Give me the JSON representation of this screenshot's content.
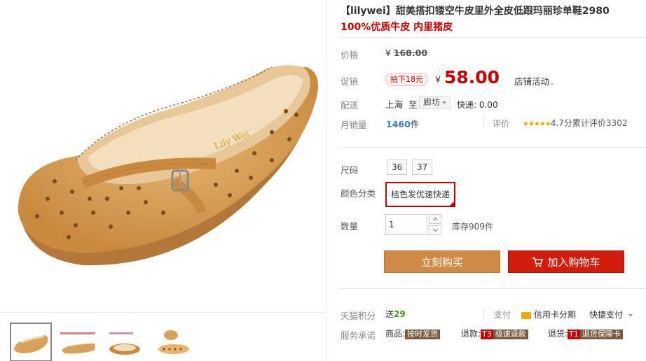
{
  "product": {
    "title": "【lilywei】甜美搭扣镂空牛皮里外全皮低跟玛丽珍单鞋2980",
    "subtitle": "100%优质牛皮 内里猪皮",
    "brand_mark": "Lily Wei"
  },
  "price": {
    "label": "价格",
    "currency": "¥",
    "original": "168.00",
    "promo_label": "促销",
    "promo_badge": "拍下18元",
    "current": "58.00",
    "activity": "店铺活动"
  },
  "shipping": {
    "label": "配送",
    "from": "上海",
    "to_word": "至",
    "destination": "廊坊",
    "express": "快递: 0.00"
  },
  "sales": {
    "label": "月销量",
    "count": "1460",
    "unit": "件",
    "rating_label": "评价",
    "stars": "★★★★★",
    "score": "4.7分",
    "reviews": "累计评价3302"
  },
  "options": {
    "size_label": "尺码",
    "sizes": [
      "36",
      "37"
    ],
    "color_label": "颜色分类",
    "color_selected": "桔色发优速快递"
  },
  "quantity": {
    "label": "数量",
    "value": "1",
    "stock": "库存909件"
  },
  "actions": {
    "buy_now": "立刻购买",
    "add_to_cart": "加入购物车"
  },
  "extras": {
    "points_label": "天猫积分",
    "points_prefix": "送",
    "points_value": "29",
    "pay_label": "支付",
    "credit_installment": "信用卡分期",
    "quick_pay": "快捷支付",
    "service_label": "服务承诺",
    "goods_label": "商品:",
    "goods_tag": "按时发货",
    "refund_label": "退款:",
    "refund_code": "T3",
    "refund_tag": "极速退款",
    "return_label": "退货:",
    "return_code": "T1",
    "return_tag": "退货保障卡"
  },
  "colors": {
    "accent_red": "#c40000",
    "buy_orange": "#d08a46",
    "cart_red": "#d21c0c",
    "shoe_tan": "#d9a25c"
  },
  "icons": [
    "cart-icon",
    "credit-card-icon",
    "chevron-down-icon",
    "stepper-up-icon",
    "stepper-down-icon",
    "check-corner-icon"
  ]
}
